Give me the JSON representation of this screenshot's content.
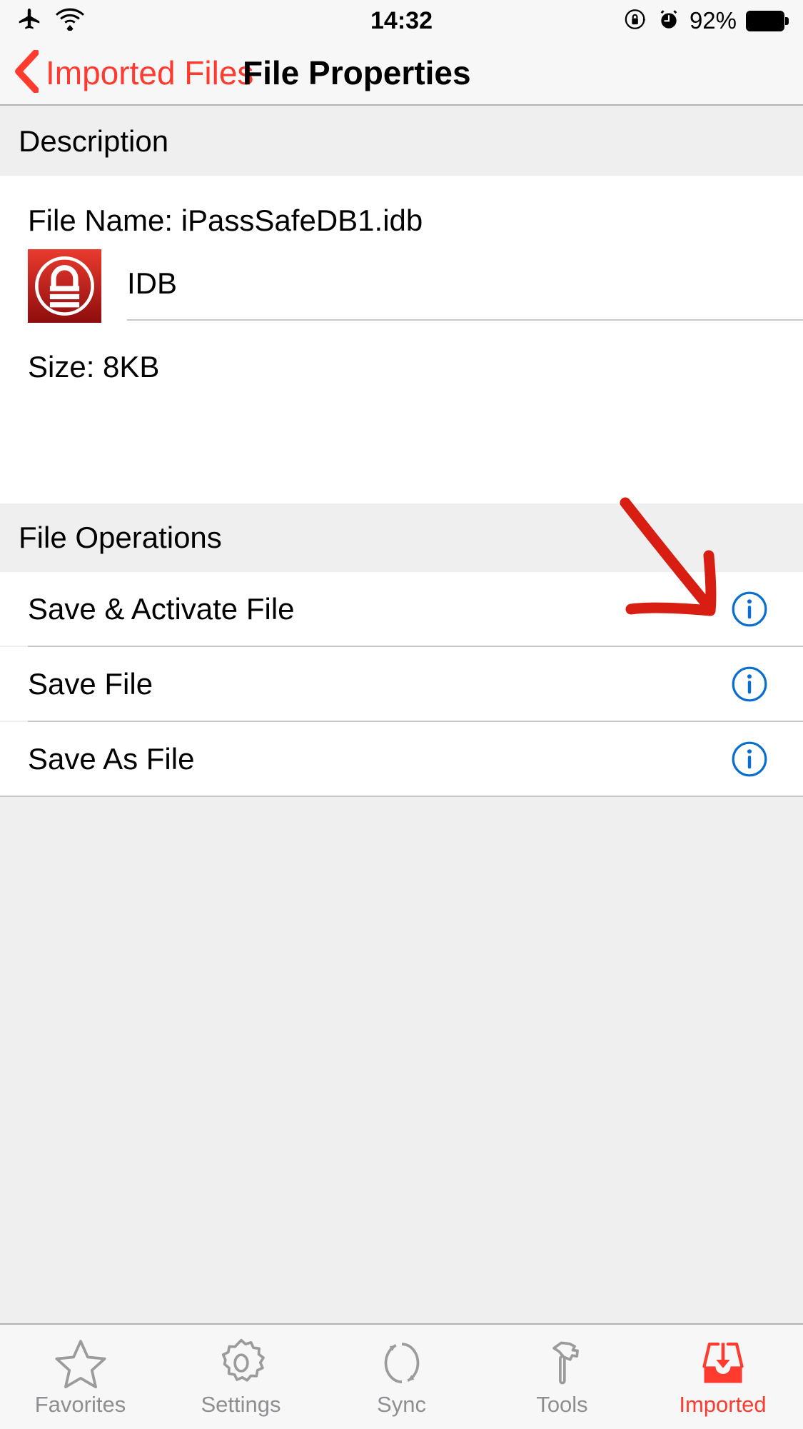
{
  "status_bar": {
    "airplane_icon": "airplane-mode-icon",
    "wifi_icon": "wifi-icon",
    "time": "14:32",
    "rotation_lock_icon": "rotation-lock-icon",
    "alarm_icon": "alarm-clock-icon",
    "battery_percent": "92%",
    "battery_icon": "battery-full-icon"
  },
  "nav_bar": {
    "back_icon": "chevron-left-icon",
    "back_label": "Imported Files",
    "title": "File Properties",
    "tint_color": "#FF3B30"
  },
  "sections": [
    {
      "header": "Description",
      "rows": [
        {
          "name": "file-name-row",
          "text": "File Name: iPassSafeDB1.idb"
        },
        {
          "name": "file-type-row",
          "icon": "keepass-lock-icon",
          "text": "IDB"
        },
        {
          "name": "file-size-row",
          "text": "Size:  8KB"
        }
      ]
    },
    {
      "header": "File Operations",
      "rows": [
        {
          "name": "save-activate-file-row",
          "text": "Save & Activate File",
          "accessory": "info-icon"
        },
        {
          "name": "save-file-row",
          "text": "Save File",
          "accessory": "info-icon"
        },
        {
          "name": "save-as-file-row",
          "text": "Save As File",
          "accessory": "info-icon"
        }
      ]
    }
  ],
  "annotation": {
    "type": "hand-drawn-arrow",
    "color": "#d81e12",
    "points_to": "save-activate-file-info-icon"
  },
  "tab_bar": {
    "active_index": 4,
    "active_color": "#FF3B30",
    "inactive_color": "#8e8e93",
    "items": [
      {
        "label": "Favorites",
        "icon": "star-icon"
      },
      {
        "label": "Settings",
        "icon": "gear-icon"
      },
      {
        "label": "Sync",
        "icon": "sync-circular-arrows-icon"
      },
      {
        "label": "Tools",
        "icon": "hammer-icon"
      },
      {
        "label": "Imported",
        "icon": "inbox-download-tray-icon"
      }
    ]
  },
  "colors": {
    "info_blue": "#0a6ed1",
    "section_header_bg": "#efeff0",
    "separator": "#c8c7cc",
    "icon_red": "#cf1010"
  }
}
